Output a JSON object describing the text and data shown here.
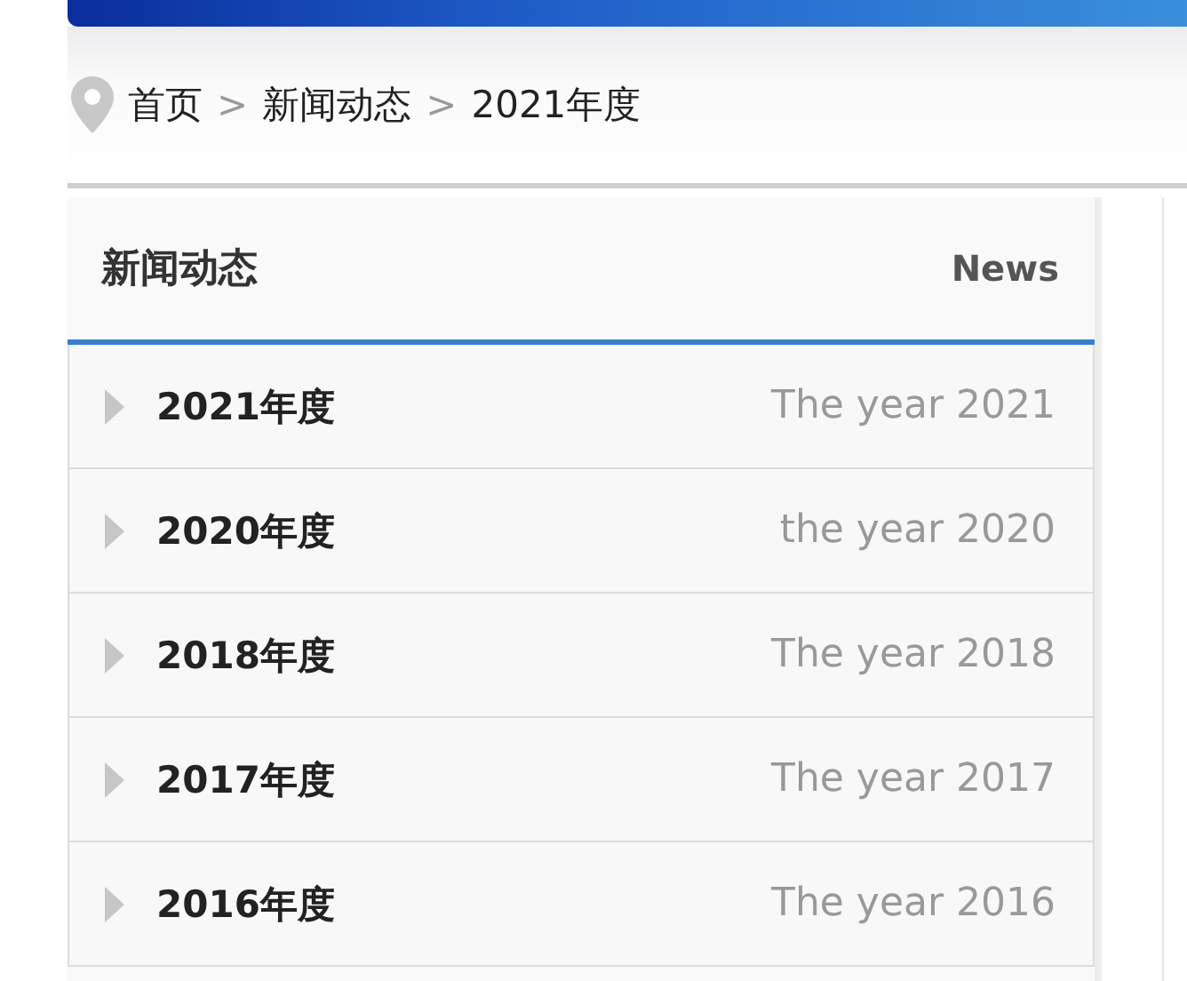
{
  "breadcrumb": [
    {
      "kind": "link",
      "text": "首页"
    },
    {
      "kind": "separator",
      "text": ">"
    },
    {
      "kind": "link",
      "text": "新闻动态"
    },
    {
      "kind": "separator",
      "text": ">"
    },
    {
      "kind": "current",
      "text": "2021年度"
    }
  ],
  "sidebar": {
    "title": "新闻动态",
    "subtitle": "News",
    "items": [
      {
        "label": "2021年度",
        "english": "The year 2021"
      },
      {
        "label": "2020年度",
        "english": "the year 2020"
      },
      {
        "label": "2018年度",
        "english": "The year 2018"
      },
      {
        "label": "2017年度",
        "english": "The year 2017"
      },
      {
        "label": "2016年度",
        "english": "The year 2016"
      }
    ]
  }
}
